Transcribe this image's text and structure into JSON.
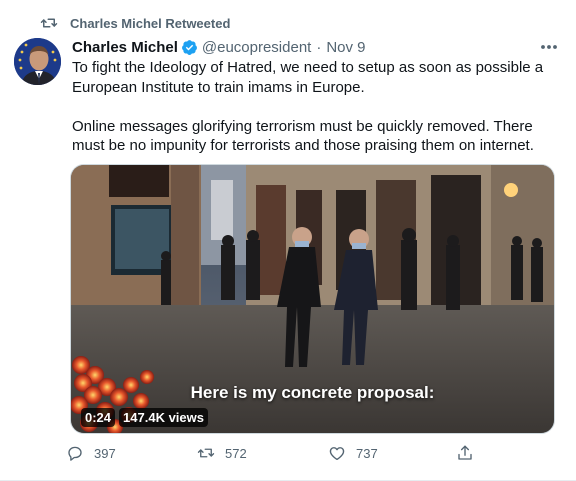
{
  "retweet": {
    "label": "Charles Michel Retweeted",
    "icon": "retweet-icon"
  },
  "author": {
    "name": "Charles Michel",
    "handle": "@eucopresident",
    "date_separator": "·",
    "date": "Nov 9",
    "verified_icon": "verified-badge-icon"
  },
  "tweet": {
    "paragraph_1": "To fight the Ideology of Hatred, we need to setup as soon as possible a European Institute to train imams in Europe.",
    "paragraph_2": "Online messages glorifying terrorism must be quickly removed. There must be no impunity for terrorists and those praising them on internet."
  },
  "video": {
    "subtitle": "Here is my concrete proposal:",
    "duration": "0:24",
    "views": "147.4K views"
  },
  "actions": {
    "replies": "397",
    "retweets": "572",
    "likes": "737"
  },
  "colors": {
    "accent": "#1da1f2",
    "muted": "#536471",
    "text": "#0f1419"
  }
}
